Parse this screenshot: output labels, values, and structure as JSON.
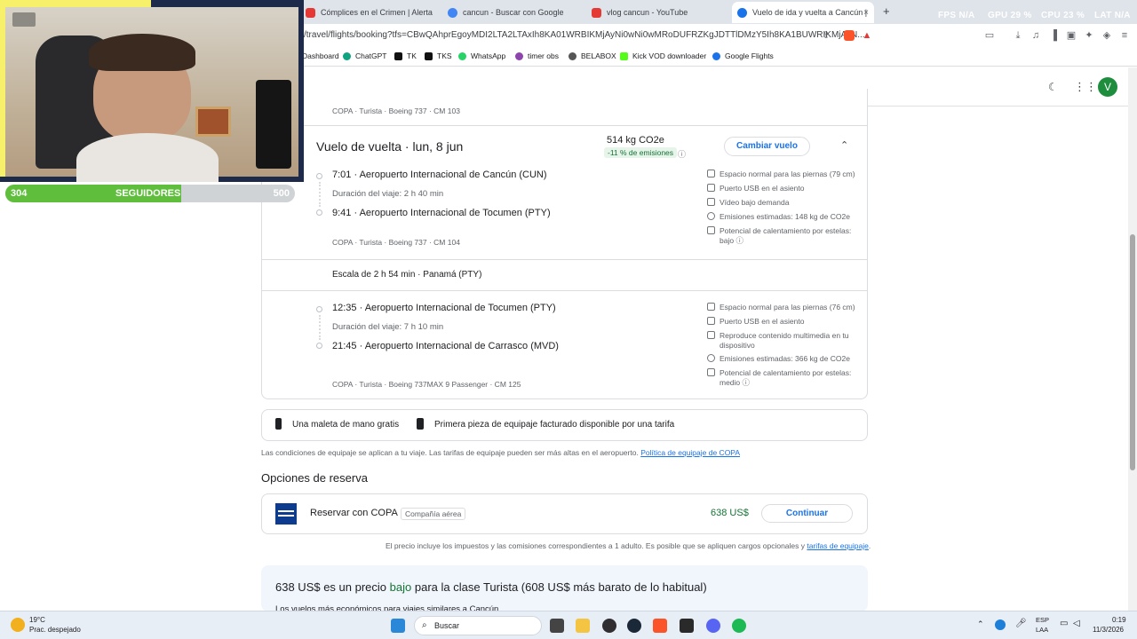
{
  "browser": {
    "tabs": [
      {
        "title": "Cómplices en el Crimen | Alerta Aero",
        "color": "#e53935"
      },
      {
        "title": "cancun - Buscar con Google",
        "color": "#4285f4"
      },
      {
        "title": "vlog cancun - YouTube",
        "color": "#e53935"
      },
      {
        "title": "Vuelo de ida y vuelta a Cancún |",
        "color": "#1a73e8"
      }
    ],
    "close_glyph": "×",
    "new_tab_glyph": "+",
    "stats": {
      "fps_label": "FPS",
      "fps_value": "N/A",
      "gpu_label": "GPU",
      "gpu_value": "29 %",
      "cpu_label": "CPU",
      "cpu_value": "23 %",
      "lat_label": "LAT",
      "lat_value": "N/A"
    },
    "url": "/travel/flights/booking?tfs=CBwQAhprEgoyMDI2LTA2LTAxIh8KA01WRBIKMjAyNi0wNi0wMRoDUFRZKgJDTTlDMzY5Ih8KA1BUWRIKMjAyN...",
    "bookmarks": [
      {
        "label": "Dashboard",
        "color": "#ffffff"
      },
      {
        "label": "ChatGPT",
        "color": "#10a37f"
      },
      {
        "label": "TK",
        "color": "#111111"
      },
      {
        "label": "TKS",
        "color": "#111111"
      },
      {
        "label": "WhatsApp",
        "color": "#25d366"
      },
      {
        "label": "timer obs",
        "color": "#8e44ad"
      },
      {
        "label": "BELABOX",
        "color": "#555555"
      },
      {
        "label": "Kick VOD downloader",
        "color": "#53fc18"
      },
      {
        "label": "Google Flights",
        "color": "#1a73e8"
      }
    ]
  },
  "header": {
    "avatar_letter": "V"
  },
  "outbound_tail": {
    "detail": "COPA · Turista · Boeing 737 · CM 103"
  },
  "return": {
    "title": "Vuelo de vuelta",
    "date": "lun, 8 jun",
    "co2": "514 kg CO2e",
    "co2_delta": "-11 % de emisiones",
    "change_button": "Cambiar vuelo",
    "seg1": {
      "dep": "7:01 · Aeropuerto Internacional de Cancún (CUN)",
      "duration": "Duración del viaje: 2 h 40 min",
      "arr": "9:41 · Aeropuerto Internacional de Tocumen (PTY)",
      "detail": "COPA · Turista · Boeing 737 · CM 104",
      "amenities": [
        "Espacio normal para las piernas (79 cm)",
        "Puerto USB en el asiento",
        "Vídeo bajo demanda",
        "Emisiones estimadas: 148 kg de CO2e",
        "Potencial de calentamiento por estelas:",
        "bajo"
      ]
    },
    "layover": "Escala de 2 h 54 min · Panamá (PTY)",
    "seg2": {
      "dep": "12:35 · Aeropuerto Internacional de Tocumen (PTY)",
      "duration": "Duración del viaje: 7 h 10 min",
      "arr": "21:45 · Aeropuerto Internacional de Carrasco (MVD)",
      "detail": "COPA · Turista · Boeing 737MAX 9 Passenger · CM 125",
      "amenities": [
        "Espacio normal para las piernas (76 cm)",
        "Puerto USB en el asiento",
        "Reproduce contenido multimedia en tu",
        "dispositivo",
        "Emisiones estimadas: 366 kg de CO2e",
        "Potencial de calentamiento por estelas:",
        "medio"
      ]
    }
  },
  "baggage": {
    "carry_on": "Una maleta de mano gratis",
    "checked": "Primera pieza de equipaje facturado disponible por una tarifa",
    "note": "Las condiciones de equipaje se aplican a tu viaje. Las tarifas de equipaje pueden ser más altas en el aeropuerto.",
    "policy_link": "Política de equipaje de COPA"
  },
  "booking": {
    "heading": "Opciones de reserva",
    "book_with": "Reservar con COPA",
    "badge": "Compañía aérea",
    "price": "638 US$",
    "continue": "Continuar",
    "fine_print": "El precio incluye los impuestos y las comisiones correspondientes a 1 adulto. Es posible que se apliquen cargos opcionales y",
    "fine_link": "tarifas de equipaje",
    "fine_end": "."
  },
  "price_insight": {
    "pre": "638 US$ es un precio",
    "low": "bajo",
    "post": "para la clase Turista (608 US$ más barato de lo habitual)",
    "cut": "Los vuelos más económicos para viajes similares a Cancún"
  },
  "overlay": {
    "followers_current": "304",
    "followers_label": "SEGUIDORES",
    "followers_goal": "500",
    "progress": 0.608
  },
  "taskbar": {
    "weather_temp": "19°C",
    "weather_desc": "Prac. despejado",
    "search_placeholder": "Buscar",
    "lang1": "ESP",
    "lang2": "LAA",
    "time": "0:19",
    "date": "11/3/2026",
    "apps": [
      {
        "name": "windows",
        "color": "#2b88d8"
      },
      {
        "name": "task-view",
        "color": "#444444"
      },
      {
        "name": "file-explorer",
        "color": "#f4c542"
      },
      {
        "name": "obs",
        "color": "#302e31"
      },
      {
        "name": "steam",
        "color": "#1b2838"
      },
      {
        "name": "brave",
        "color": "#fb542b"
      },
      {
        "name": "epic",
        "color": "#2a2a2a"
      },
      {
        "name": "discord",
        "color": "#5865f2"
      },
      {
        "name": "spotify",
        "color": "#1db954"
      }
    ]
  }
}
